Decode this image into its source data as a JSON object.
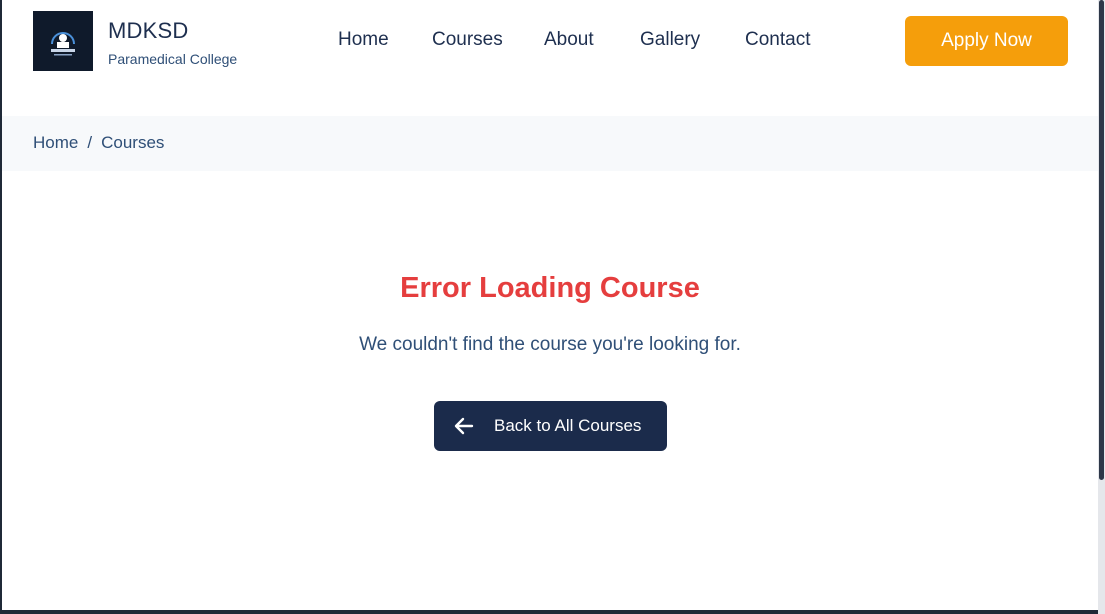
{
  "brand": {
    "name": "MDKSD",
    "subtitle": "Paramedical College",
    "logo_text": "MDKSD"
  },
  "nav": {
    "items": [
      {
        "label": "Home"
      },
      {
        "label": "Courses"
      },
      {
        "label": "About"
      },
      {
        "label": "Gallery"
      },
      {
        "label": "Contact"
      }
    ],
    "apply_label": "Apply Now"
  },
  "breadcrumb": {
    "items": [
      "Home",
      "Courses"
    ],
    "separator": "/"
  },
  "error": {
    "title": "Error Loading Course",
    "message": "We couldn't find the course you're looking for.",
    "back_label": "Back to All Courses",
    "back_icon": "arrow-left-icon"
  },
  "colors": {
    "accent": "#f59e0b",
    "navy": "#1b2b4b",
    "error": "#e53e3e",
    "text": "#2f4f77"
  }
}
